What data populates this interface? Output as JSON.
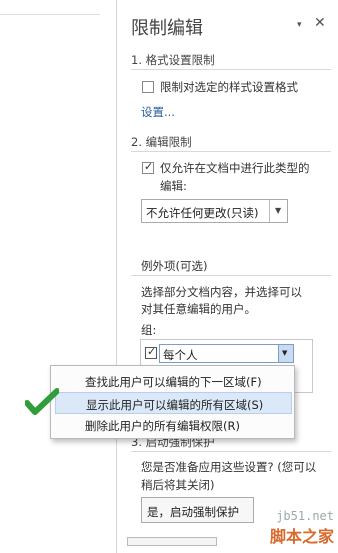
{
  "pane": {
    "title": "限制编辑",
    "menu_btn": "▾",
    "close_btn": "✕"
  },
  "section1": {
    "heading": "1. 格式设置限制",
    "checkbox_label": "限制对选定的样式设置格式",
    "checkbox_checked": false,
    "settings_link": "设置..."
  },
  "section2": {
    "heading": "2. 编辑限制",
    "checkbox_label_line1": "仅允许在文档中进行此类型的",
    "checkbox_label_line2": "编辑:",
    "checkbox_checked": true,
    "select_value": "不允许任何更改(只读)",
    "exceptions_heading": "例外项(可选)",
    "exceptions_desc_line1": "选择部分文档内容，并选择可以",
    "exceptions_desc_line2": "对其任意编辑的用户。",
    "group_label": "组:",
    "group_item": "每个人",
    "group_checked": true
  },
  "section3": {
    "heading": "3. 启动强制保护",
    "question_line1": "您是否准备应用这些设置? (您可以",
    "question_line2": "稍后将其关闭)",
    "start_button": "是，启动强制保护"
  },
  "context_menu": {
    "items": [
      {
        "label": "查找此用户可以编辑的下一区域(F)",
        "highlighted": false
      },
      {
        "label": "显示此用户可以编辑的所有区域(S)",
        "highlighted": true
      },
      {
        "label": "删除此用户的所有编辑权限(R)",
        "highlighted": false
      }
    ]
  },
  "watermark": {
    "site": "jb51.net",
    "brand": "脚本之家"
  },
  "colors": {
    "accent_link": "#2a5d9f",
    "highlight": "#dbe8f8",
    "check_green": "#2e9d3a"
  }
}
